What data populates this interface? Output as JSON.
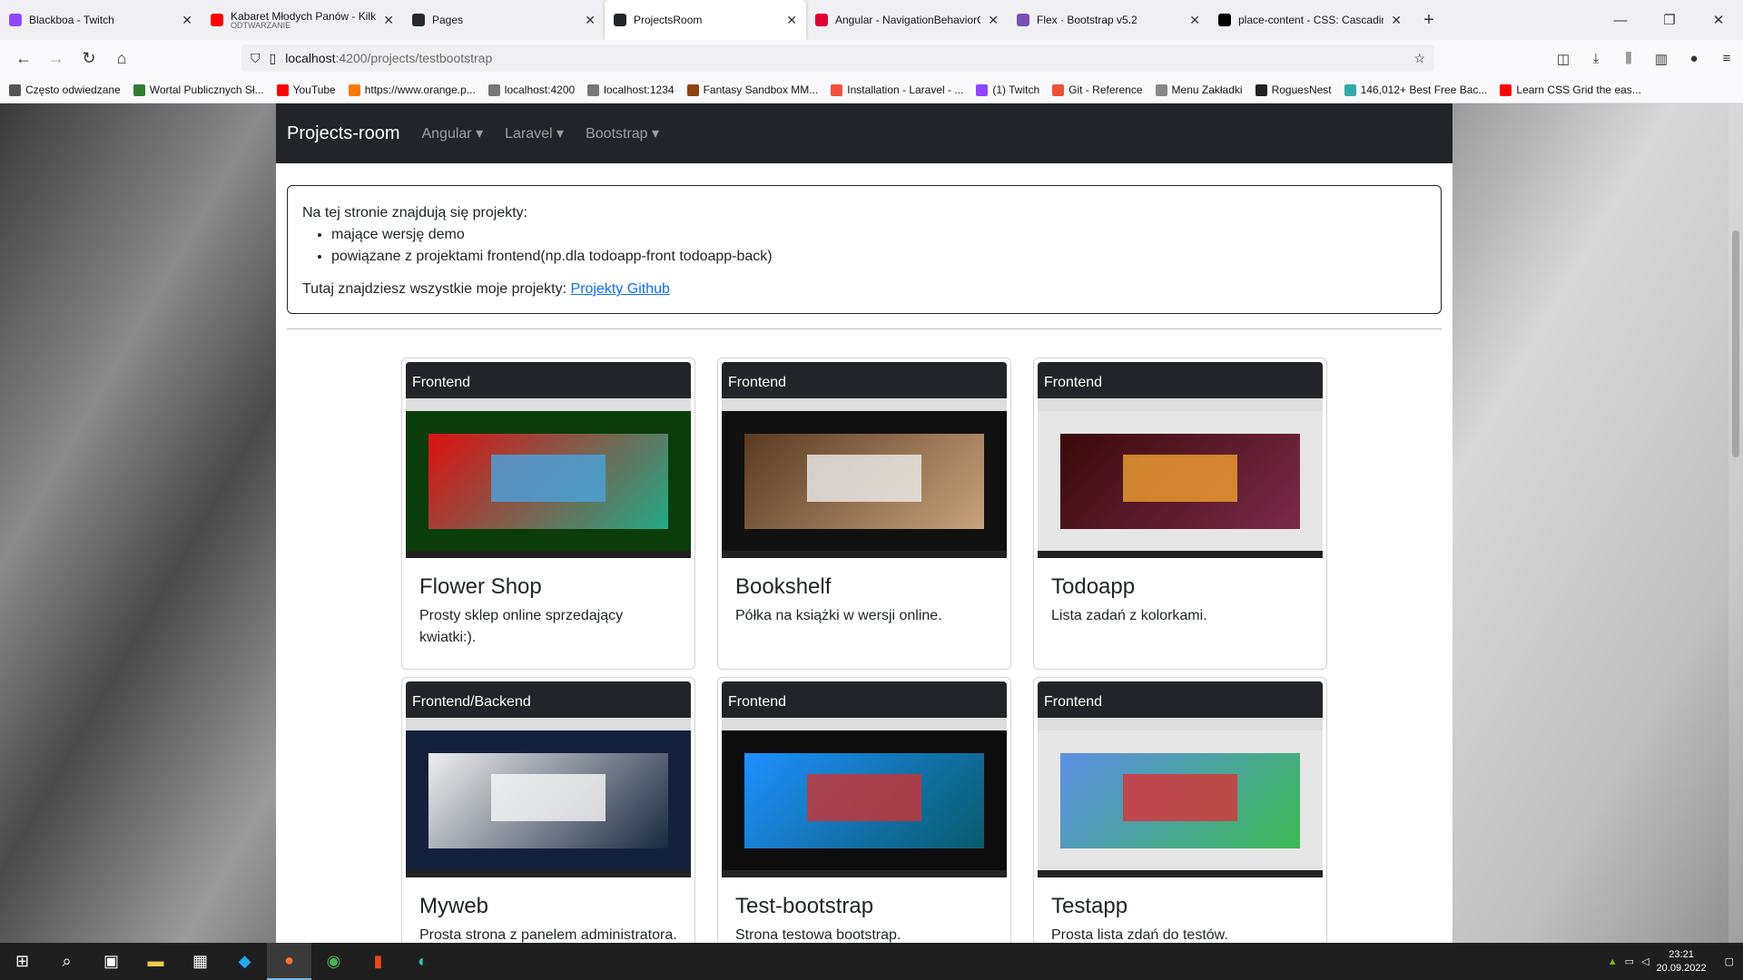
{
  "tabs": [
    {
      "title": "Blackboa - Twitch",
      "icon": "twitch-icon",
      "color": "#9146ff"
    },
    {
      "title": "Kabaret Młodych Panów - Kilka",
      "sub": "ODTWARZANIE",
      "icon": "youtube-icon",
      "color": "#ff0000"
    },
    {
      "title": "Pages",
      "icon": "github-icon",
      "color": "#24292f"
    },
    {
      "title": "ProjectsRoom",
      "icon": "angular-icon",
      "color": "#212529",
      "active": true
    },
    {
      "title": "Angular - NavigationBehaviorO",
      "icon": "angular-icon",
      "color": "#dd0031"
    },
    {
      "title": "Flex · Bootstrap v5.2",
      "icon": "bootstrap-icon",
      "color": "#7952b3"
    },
    {
      "title": "place-content - CSS: Cascading",
      "icon": "mdn-icon",
      "color": "#000000"
    }
  ],
  "url": {
    "host": "localhost",
    "path": ":4200/projects/testbootstrap"
  },
  "bookmarks": [
    {
      "label": "Często odwiedzane",
      "color": "#555"
    },
    {
      "label": "Wortal Publicznych Sł...",
      "color": "#2e7d32"
    },
    {
      "label": "YouTube",
      "color": "#ff0000"
    },
    {
      "label": "https://www.orange.p...",
      "color": "#ff7900"
    },
    {
      "label": "localhost:4200",
      "color": "#777"
    },
    {
      "label": "localhost:1234",
      "color": "#777"
    },
    {
      "label": "Fantasy Sandbox MM...",
      "color": "#8b4513"
    },
    {
      "label": "Installation - Laravel - ...",
      "color": "#f05340"
    },
    {
      "label": "(1) Twitch",
      "color": "#9146ff"
    },
    {
      "label": "Git - Reference",
      "color": "#f05033"
    },
    {
      "label": "Menu Zakładki",
      "color": "#888"
    },
    {
      "label": "RoguesNest",
      "color": "#222"
    },
    {
      "label": "146,012+ Best Free Bac...",
      "color": "#3aa"
    },
    {
      "label": "Learn CSS Grid the eas...",
      "color": "#ff0000"
    }
  ],
  "app": {
    "brand": "Projects-room",
    "nav": [
      "Angular",
      "Laravel",
      "Bootstrap"
    ]
  },
  "intro": {
    "heading": "Na tej stronie znajdują się projekty:",
    "items": [
      "mające wersję demo",
      "powiązane z projektami frontend(np.dla todoapp-front todoapp-back)"
    ],
    "footer": "Tutaj znajdziesz wszystkie moje projekty:",
    "link": "Projekty Github"
  },
  "cards": [
    {
      "category": "Frontend",
      "title": "Flower Shop",
      "desc": "Prosty sklep online sprzedający kwiatki:).",
      "preview": [
        "#0b3d0b",
        "#d11",
        "#2a8",
        "#4aa3df"
      ]
    },
    {
      "category": "Frontend",
      "title": "Bookshelf",
      "desc": "Półka na książki w wersji online.",
      "preview": [
        "#111",
        "#5a3a22",
        "#c9a27a",
        "#eee"
      ]
    },
    {
      "category": "Frontend",
      "title": "Todoapp",
      "desc": "Lista zadań z kolorkami.",
      "preview": [
        "#e5e5e5",
        "#3a0a0a",
        "#7b2a4a",
        "#f0a030"
      ]
    },
    {
      "category": "Frontend/Backend",
      "title": "Myweb",
      "desc": "Prosta strona z panelem administratora.",
      "preview": [
        "#14213d",
        "#eeeeee",
        "#1b2a40",
        "#f7f7f7"
      ]
    },
    {
      "category": "Frontend",
      "title": "Test-bootstrap",
      "desc": "Strona testowa bootstrap.",
      "preview": [
        "#0d0d0d",
        "#1e90ff",
        "#0a5a6a",
        "#c33"
      ]
    },
    {
      "category": "Frontend",
      "title": "Testapp",
      "desc": "Prosta lista zdań do testów.",
      "preview": [
        "#e5e5e5",
        "#5b8ee6",
        "#3cba54",
        "#db3236"
      ]
    }
  ],
  "clock": {
    "time": "23:21",
    "date": "20.09.2022"
  }
}
